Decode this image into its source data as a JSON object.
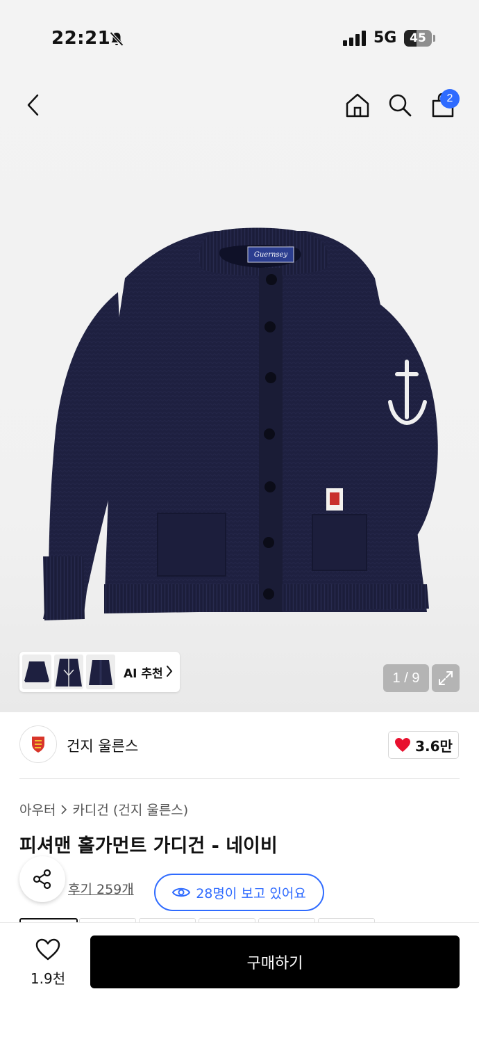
{
  "status_bar": {
    "time": "22:21",
    "network": "5G",
    "battery": "45",
    "battery_level_percent": 45
  },
  "header": {
    "cart_count": "2",
    "icons": [
      "back-chevron-icon",
      "home-icon",
      "search-icon",
      "shopping-bag-icon"
    ]
  },
  "gallery": {
    "ai_label": "AI 추천",
    "counter": "1 / 9"
  },
  "brand": {
    "name": "건지 울른스",
    "likes": "3.6만"
  },
  "product": {
    "breadcrumb": [
      "아우터",
      "카디건 (건지 울른스)"
    ],
    "title": "피셔맨 홀가먼트 가디건 - 네이비",
    "reviews": "후기 259개",
    "viewers": "28명이 보고 있어요"
  },
  "bottom_bar": {
    "fav_count": "1.9천",
    "buy_label": "구매하기"
  },
  "colors": {
    "accent": "#2f6bff",
    "heart": "#e8102e",
    "product_navy": "#1d1f3d"
  }
}
